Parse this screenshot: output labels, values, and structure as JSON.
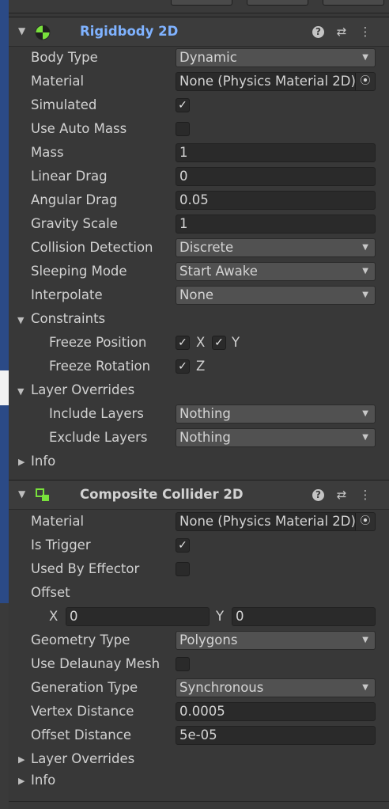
{
  "colors": {
    "accent_title": "#7fb2ff",
    "rb_icon": "#79e13c",
    "cc_icon": "#79e13c",
    "left_strip_blue": "#2b4a86"
  },
  "rigidbody": {
    "title": "Rigidbody 2D",
    "icon": "rigidbody-2d-icon",
    "body_type_label": "Body Type",
    "body_type_value": "Dynamic",
    "material_label": "Material",
    "material_value": "None (Physics Material 2D)",
    "simulated_label": "Simulated",
    "simulated_checked": true,
    "use_auto_mass_label": "Use Auto Mass",
    "use_auto_mass_checked": false,
    "mass_label": "Mass",
    "mass_value": "1",
    "linear_drag_label": "Linear Drag",
    "linear_drag_value": "0",
    "angular_drag_label": "Angular Drag",
    "angular_drag_value": "0.05",
    "gravity_scale_label": "Gravity Scale",
    "gravity_scale_value": "1",
    "collision_detection_label": "Collision Detection",
    "collision_detection_value": "Discrete",
    "sleeping_mode_label": "Sleeping Mode",
    "sleeping_mode_value": "Start Awake",
    "interpolate_label": "Interpolate",
    "interpolate_value": "None",
    "constraints_label": "Constraints",
    "freeze_position_label": "Freeze Position",
    "freeze_position_x": "X",
    "freeze_position_y": "Y",
    "freeze_rotation_label": "Freeze Rotation",
    "freeze_rotation_z": "Z",
    "layer_overrides_label": "Layer Overrides",
    "include_layers_label": "Include Layers",
    "include_layers_value": "Nothing",
    "exclude_layers_label": "Exclude Layers",
    "exclude_layers_value": "Nothing",
    "info_label": "Info"
  },
  "composite": {
    "title": "Composite Collider 2D",
    "icon": "composite-collider-2d-icon",
    "material_label": "Material",
    "material_value": "None (Physics Material 2D)",
    "is_trigger_label": "Is Trigger",
    "is_trigger_checked": true,
    "used_by_effector_label": "Used By Effector",
    "used_by_effector_checked": false,
    "offset_label": "Offset",
    "offset_x_label": "X",
    "offset_x_value": "0",
    "offset_y_label": "Y",
    "offset_y_value": "0",
    "geometry_type_label": "Geometry Type",
    "geometry_type_value": "Polygons",
    "use_delaunay_label": "Use Delaunay Mesh",
    "use_delaunay_checked": false,
    "generation_type_label": "Generation Type",
    "generation_type_value": "Synchronous",
    "vertex_distance_label": "Vertex Distance",
    "vertex_distance_value": "0.0005",
    "offset_distance_label": "Offset Distance",
    "offset_distance_value": "5e-05",
    "layer_overrides_label": "Layer Overrides",
    "info_label": "Info"
  },
  "header_buttons": {
    "help": "?",
    "presets": "⇄",
    "menu": "⋮"
  }
}
